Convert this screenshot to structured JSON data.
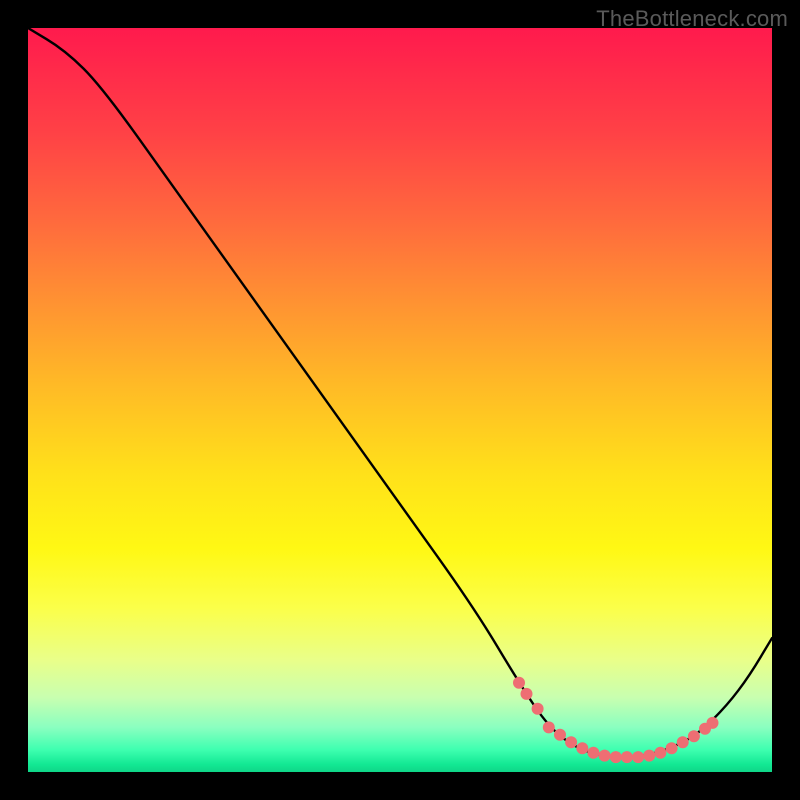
{
  "watermark": "TheBottleneck.com",
  "chart_data": {
    "type": "line",
    "title": "",
    "xlabel": "",
    "ylabel": "",
    "xlim": [
      0,
      100
    ],
    "ylim": [
      0,
      100
    ],
    "grid": false,
    "curve": [
      {
        "x": 0,
        "y": 100
      },
      {
        "x": 5,
        "y": 97
      },
      {
        "x": 10,
        "y": 92
      },
      {
        "x": 20,
        "y": 78
      },
      {
        "x": 30,
        "y": 64
      },
      {
        "x": 40,
        "y": 50
      },
      {
        "x": 50,
        "y": 36
      },
      {
        "x": 60,
        "y": 22
      },
      {
        "x": 66,
        "y": 12
      },
      {
        "x": 70,
        "y": 6
      },
      {
        "x": 74,
        "y": 3
      },
      {
        "x": 78,
        "y": 2
      },
      {
        "x": 82,
        "y": 2
      },
      {
        "x": 86,
        "y": 3
      },
      {
        "x": 90,
        "y": 5
      },
      {
        "x": 94,
        "y": 9
      },
      {
        "x": 97,
        "y": 13
      },
      {
        "x": 100,
        "y": 18
      }
    ],
    "highlight_points": [
      {
        "x": 66,
        "y": 12
      },
      {
        "x": 67,
        "y": 10.5
      },
      {
        "x": 68.5,
        "y": 8.5
      },
      {
        "x": 70,
        "y": 6
      },
      {
        "x": 71.5,
        "y": 5
      },
      {
        "x": 73,
        "y": 4
      },
      {
        "x": 74.5,
        "y": 3.2
      },
      {
        "x": 76,
        "y": 2.6
      },
      {
        "x": 77.5,
        "y": 2.2
      },
      {
        "x": 79,
        "y": 2
      },
      {
        "x": 80.5,
        "y": 2
      },
      {
        "x": 82,
        "y": 2
      },
      {
        "x": 83.5,
        "y": 2.2
      },
      {
        "x": 85,
        "y": 2.6
      },
      {
        "x": 86.5,
        "y": 3.2
      },
      {
        "x": 88,
        "y": 4
      },
      {
        "x": 89.5,
        "y": 4.8
      },
      {
        "x": 91,
        "y": 5.8
      },
      {
        "x": 92,
        "y": 6.6
      }
    ],
    "gradient_stops": [
      {
        "pos": 0.0,
        "color": "#ff1a4d"
      },
      {
        "pos": 0.5,
        "color": "#ffe11a"
      },
      {
        "pos": 0.9,
        "color": "#c8ffb0"
      },
      {
        "pos": 1.0,
        "color": "#0fd688"
      }
    ]
  }
}
